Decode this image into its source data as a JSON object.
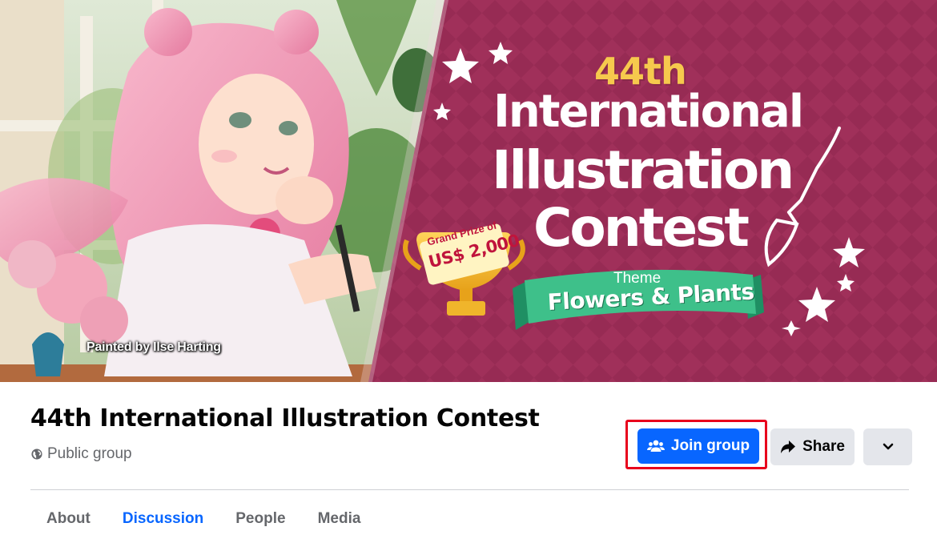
{
  "cover": {
    "credit": "Painted by Ilse Harting",
    "banner": {
      "headline_number": "44th",
      "headline_line1": "International",
      "headline_line2": "Illustration",
      "headline_line3": "Contest",
      "theme_label": "Theme",
      "theme_value": "Flowers & Plants",
      "prize_label": "Grand Prize of",
      "prize_amount": "US$ 2,000"
    }
  },
  "group": {
    "title": "44th International Illustration Contest",
    "privacy": "Public group"
  },
  "actions": {
    "join_label": "Join group",
    "share_label": "Share"
  },
  "tabs": [
    {
      "label": "About"
    },
    {
      "label": "Discussion"
    },
    {
      "label": "People"
    },
    {
      "label": "Media"
    }
  ],
  "colors": {
    "accent": "#0866ff",
    "banner_bg": "#9e2b52",
    "highlight": "#e8001c"
  }
}
